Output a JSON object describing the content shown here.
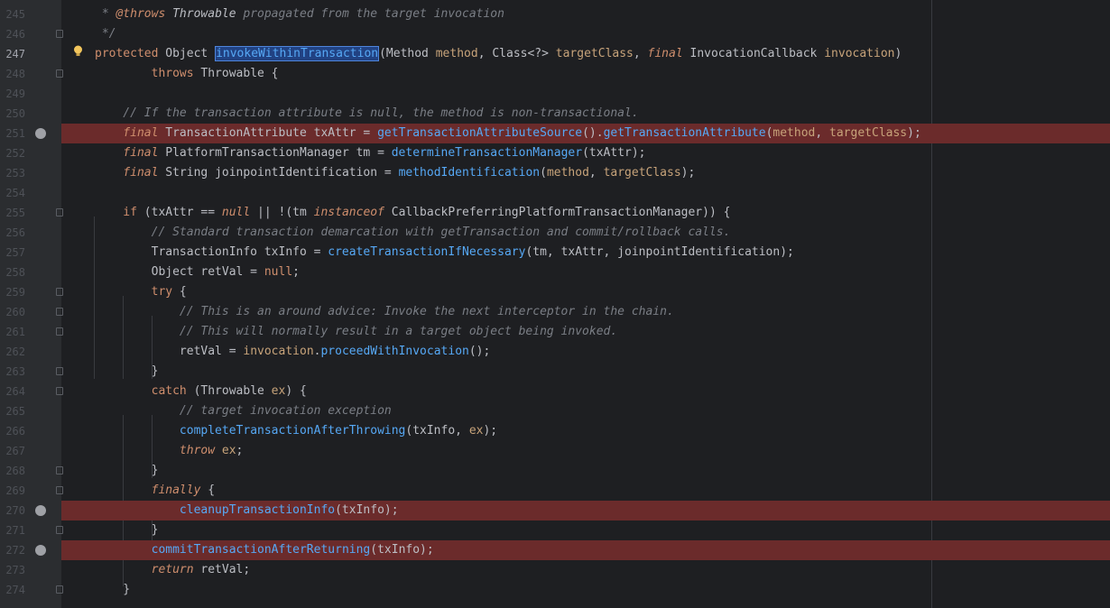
{
  "lines": [
    {
      "no": "245",
      "tokens": [
        {
          "t": " * ",
          "c": "cmgray"
        },
        {
          "t": "@throws",
          "c": "kw it"
        },
        {
          "t": " Throwable ",
          "c": "ty it"
        },
        {
          "t": "propagated from the target invocation",
          "c": "cmgray"
        }
      ]
    },
    {
      "no": "246",
      "tokens": [
        {
          "t": " */",
          "c": "cmgray"
        }
      ]
    },
    {
      "no": "247",
      "tokens": [
        {
          "t": "protected ",
          "c": "kw"
        },
        {
          "t": "Object ",
          "c": "ty"
        },
        {
          "t": "invokeWithinTransaction",
          "c": "fnsel"
        },
        {
          "t": "(Method ",
          "c": "ty"
        },
        {
          "t": "method",
          "c": "param"
        },
        {
          "t": ", Class<?> ",
          "c": "ty"
        },
        {
          "t": "targetClass",
          "c": "param"
        },
        {
          "t": ", ",
          "c": "ty"
        },
        {
          "t": "final ",
          "c": "kw it"
        },
        {
          "t": "InvocationCallback ",
          "c": "ty"
        },
        {
          "t": "invocation",
          "c": "param"
        },
        {
          "t": ")",
          "c": "ty"
        }
      ]
    },
    {
      "no": "248",
      "tokens": [
        {
          "t": "        throws ",
          "c": "kw"
        },
        {
          "t": "Throwable {",
          "c": "ty"
        }
      ]
    },
    {
      "no": "249",
      "tokens": []
    },
    {
      "no": "250",
      "tokens": [
        {
          "t": "    // If the transaction attribute is null, the method is non-transactional.",
          "c": "cmgray"
        }
      ]
    },
    {
      "no": "251",
      "tokens": [
        {
          "t": "    final ",
          "c": "kw it"
        },
        {
          "t": "TransactionAttribute txAttr = ",
          "c": "ty"
        },
        {
          "t": "getTransactionAttributeSource",
          "c": "fn"
        },
        {
          "t": "().",
          "c": "ty"
        },
        {
          "t": "getTransactionAttribute",
          "c": "fn"
        },
        {
          "t": "(",
          "c": "ty"
        },
        {
          "t": "method",
          "c": "param"
        },
        {
          "t": ", ",
          "c": "ty"
        },
        {
          "t": "targetClass",
          "c": "param"
        },
        {
          "t": ");",
          "c": "ty"
        }
      ]
    },
    {
      "no": "252",
      "tokens": [
        {
          "t": "    final ",
          "c": "kw it"
        },
        {
          "t": "PlatformTransactionManager tm = ",
          "c": "ty"
        },
        {
          "t": "determineTransactionManager",
          "c": "fn"
        },
        {
          "t": "(txAttr);",
          "c": "ty"
        }
      ]
    },
    {
      "no": "253",
      "tokens": [
        {
          "t": "    final ",
          "c": "kw it"
        },
        {
          "t": "String joinpointIdentification = ",
          "c": "ty"
        },
        {
          "t": "methodIdentification",
          "c": "fn"
        },
        {
          "t": "(",
          "c": "ty"
        },
        {
          "t": "method",
          "c": "param"
        },
        {
          "t": ", ",
          "c": "ty"
        },
        {
          "t": "targetClass",
          "c": "param"
        },
        {
          "t": ");",
          "c": "ty"
        }
      ]
    },
    {
      "no": "254",
      "tokens": []
    },
    {
      "no": "255",
      "tokens": [
        {
          "t": "    if ",
          "c": "kw"
        },
        {
          "t": "(txAttr == ",
          "c": "ty"
        },
        {
          "t": "null",
          "c": "kw it"
        },
        {
          "t": " || !(tm ",
          "c": "ty"
        },
        {
          "t": "instanceof ",
          "c": "kw it"
        },
        {
          "t": "CallbackPreferringPlatformTransactionManager)) {",
          "c": "ty"
        }
      ]
    },
    {
      "no": "256",
      "tokens": [
        {
          "t": "        // Standard transaction demarcation with getTransaction and commit/rollback calls.",
          "c": "cmgray"
        }
      ]
    },
    {
      "no": "257",
      "tokens": [
        {
          "t": "        TransactionInfo txInfo = ",
          "c": "ty"
        },
        {
          "t": "createTransactionIfNecessary",
          "c": "fn"
        },
        {
          "t": "(tm, txAttr, joinpointIdentification);",
          "c": "ty"
        }
      ]
    },
    {
      "no": "258",
      "tokens": [
        {
          "t": "        Object retVal = ",
          "c": "ty"
        },
        {
          "t": "null",
          "c": "kw"
        },
        {
          "t": ";",
          "c": "ty"
        }
      ]
    },
    {
      "no": "259",
      "tokens": [
        {
          "t": "        try ",
          "c": "kw"
        },
        {
          "t": "{",
          "c": "ty"
        }
      ]
    },
    {
      "no": "260",
      "tokens": [
        {
          "t": "            // This is an around advice: Invoke the next interceptor in the chain.",
          "c": "cmgray"
        }
      ]
    },
    {
      "no": "261",
      "tokens": [
        {
          "t": "            // This will normally result in a target object being invoked.",
          "c": "cmgray"
        }
      ]
    },
    {
      "no": "262",
      "tokens": [
        {
          "t": "            retVal = ",
          "c": "ty"
        },
        {
          "t": "invocation",
          "c": "param"
        },
        {
          "t": ".",
          "c": "ty"
        },
        {
          "t": "proceedWithInvocation",
          "c": "fn"
        },
        {
          "t": "();",
          "c": "ty"
        }
      ]
    },
    {
      "no": "263",
      "tokens": [
        {
          "t": "        }",
          "c": "ty"
        }
      ]
    },
    {
      "no": "264",
      "tokens": [
        {
          "t": "        catch ",
          "c": "kw"
        },
        {
          "t": "(Throwable ",
          "c": "ty"
        },
        {
          "t": "ex",
          "c": "param"
        },
        {
          "t": ") {",
          "c": "ty"
        }
      ]
    },
    {
      "no": "265",
      "tokens": [
        {
          "t": "            // target invocation exception",
          "c": "cmgray"
        }
      ]
    },
    {
      "no": "266",
      "tokens": [
        {
          "t": "            ",
          "c": "ty"
        },
        {
          "t": "completeTransactionAfterThrowing",
          "c": "fn"
        },
        {
          "t": "(txInfo, ",
          "c": "ty"
        },
        {
          "t": "ex",
          "c": "param"
        },
        {
          "t": ");",
          "c": "ty"
        }
      ]
    },
    {
      "no": "267",
      "tokens": [
        {
          "t": "            throw ",
          "c": "kw it"
        },
        {
          "t": "ex",
          "c": "param"
        },
        {
          "t": ";",
          "c": "ty"
        }
      ]
    },
    {
      "no": "268",
      "tokens": [
        {
          "t": "        }",
          "c": "ty"
        }
      ]
    },
    {
      "no": "269",
      "tokens": [
        {
          "t": "        finally ",
          "c": "kw it"
        },
        {
          "t": "{",
          "c": "ty"
        }
      ]
    },
    {
      "no": "270",
      "tokens": [
        {
          "t": "            ",
          "c": "ty"
        },
        {
          "t": "cleanupTransactionInfo",
          "c": "fn"
        },
        {
          "t": "(txInfo);",
          "c": "ty"
        }
      ]
    },
    {
      "no": "271",
      "tokens": [
        {
          "t": "        }",
          "c": "ty"
        }
      ]
    },
    {
      "no": "272",
      "tokens": [
        {
          "t": "        ",
          "c": "ty"
        },
        {
          "t": "commitTransactionAfterReturning",
          "c": "fn"
        },
        {
          "t": "(txInfo);",
          "c": "ty"
        }
      ]
    },
    {
      "no": "273",
      "tokens": [
        {
          "t": "        return ",
          "c": "kw it"
        },
        {
          "t": "retVal;",
          "c": "ty"
        }
      ]
    },
    {
      "no": "274",
      "tokens": [
        {
          "t": "    }",
          "c": "ty"
        }
      ]
    }
  ],
  "breakpoint_lines": [
    "251",
    "270",
    "272"
  ],
  "current_line": "247",
  "fold_lines": [
    "246",
    "248",
    "255",
    "259",
    "260",
    "261",
    "263",
    "264",
    "268",
    "269",
    "271",
    "274"
  ],
  "colors": {
    "breakpoint_bg": "#6b2b2b",
    "editor_bg": "#1e1f22",
    "gutter_bg": "#2b2d30"
  },
  "gutter_icons": {
    "current_line_icon": "lightbulb-icon",
    "breakpoint_icon": "breakpoint-icon"
  }
}
